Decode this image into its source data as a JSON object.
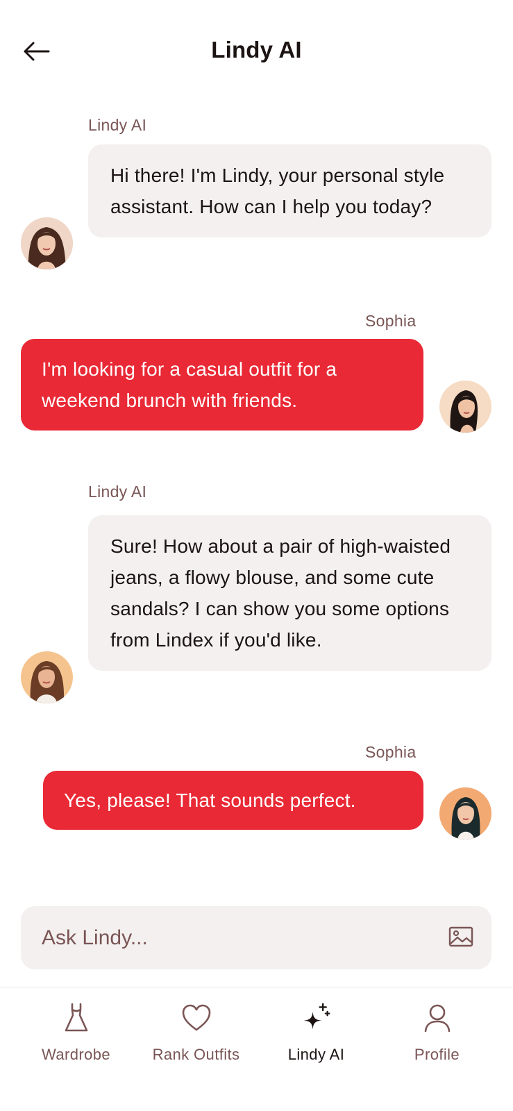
{
  "header": {
    "title": "Lindy AI",
    "back_icon": "arrow-left-icon"
  },
  "messages": [
    {
      "sender": "Lindy AI",
      "role": "ai",
      "text": "Hi there! I'm Lindy, your personal style assistant. How can I help you today?"
    },
    {
      "sender": "Sophia",
      "role": "user",
      "text": "I'm looking for a casual outfit for a weekend brunch with friends."
    },
    {
      "sender": "Lindy AI",
      "role": "ai",
      "text": "Sure! How about a pair of high-waisted jeans, a flowy blouse, and some cute sandals? I can show you some options from Lindex if you'd like."
    },
    {
      "sender": "Sophia",
      "role": "user",
      "text": "Yes, please! That sounds perfect."
    }
  ],
  "input": {
    "placeholder": "Ask Lindy...",
    "value": "",
    "attach_icon": "image-icon"
  },
  "nav": {
    "items": [
      {
        "label": "Wardrobe",
        "icon": "dress-icon",
        "active": false
      },
      {
        "label": "Rank Outfits",
        "icon": "heart-icon",
        "active": false
      },
      {
        "label": "Lindy AI",
        "icon": "sparkles-icon",
        "active": true
      },
      {
        "label": "Profile",
        "icon": "user-icon",
        "active": false
      }
    ]
  },
  "colors": {
    "accent": "#e92935",
    "ai_bubble": "#f3f0ef",
    "muted_text": "#7a5555",
    "text": "#1c1413"
  }
}
